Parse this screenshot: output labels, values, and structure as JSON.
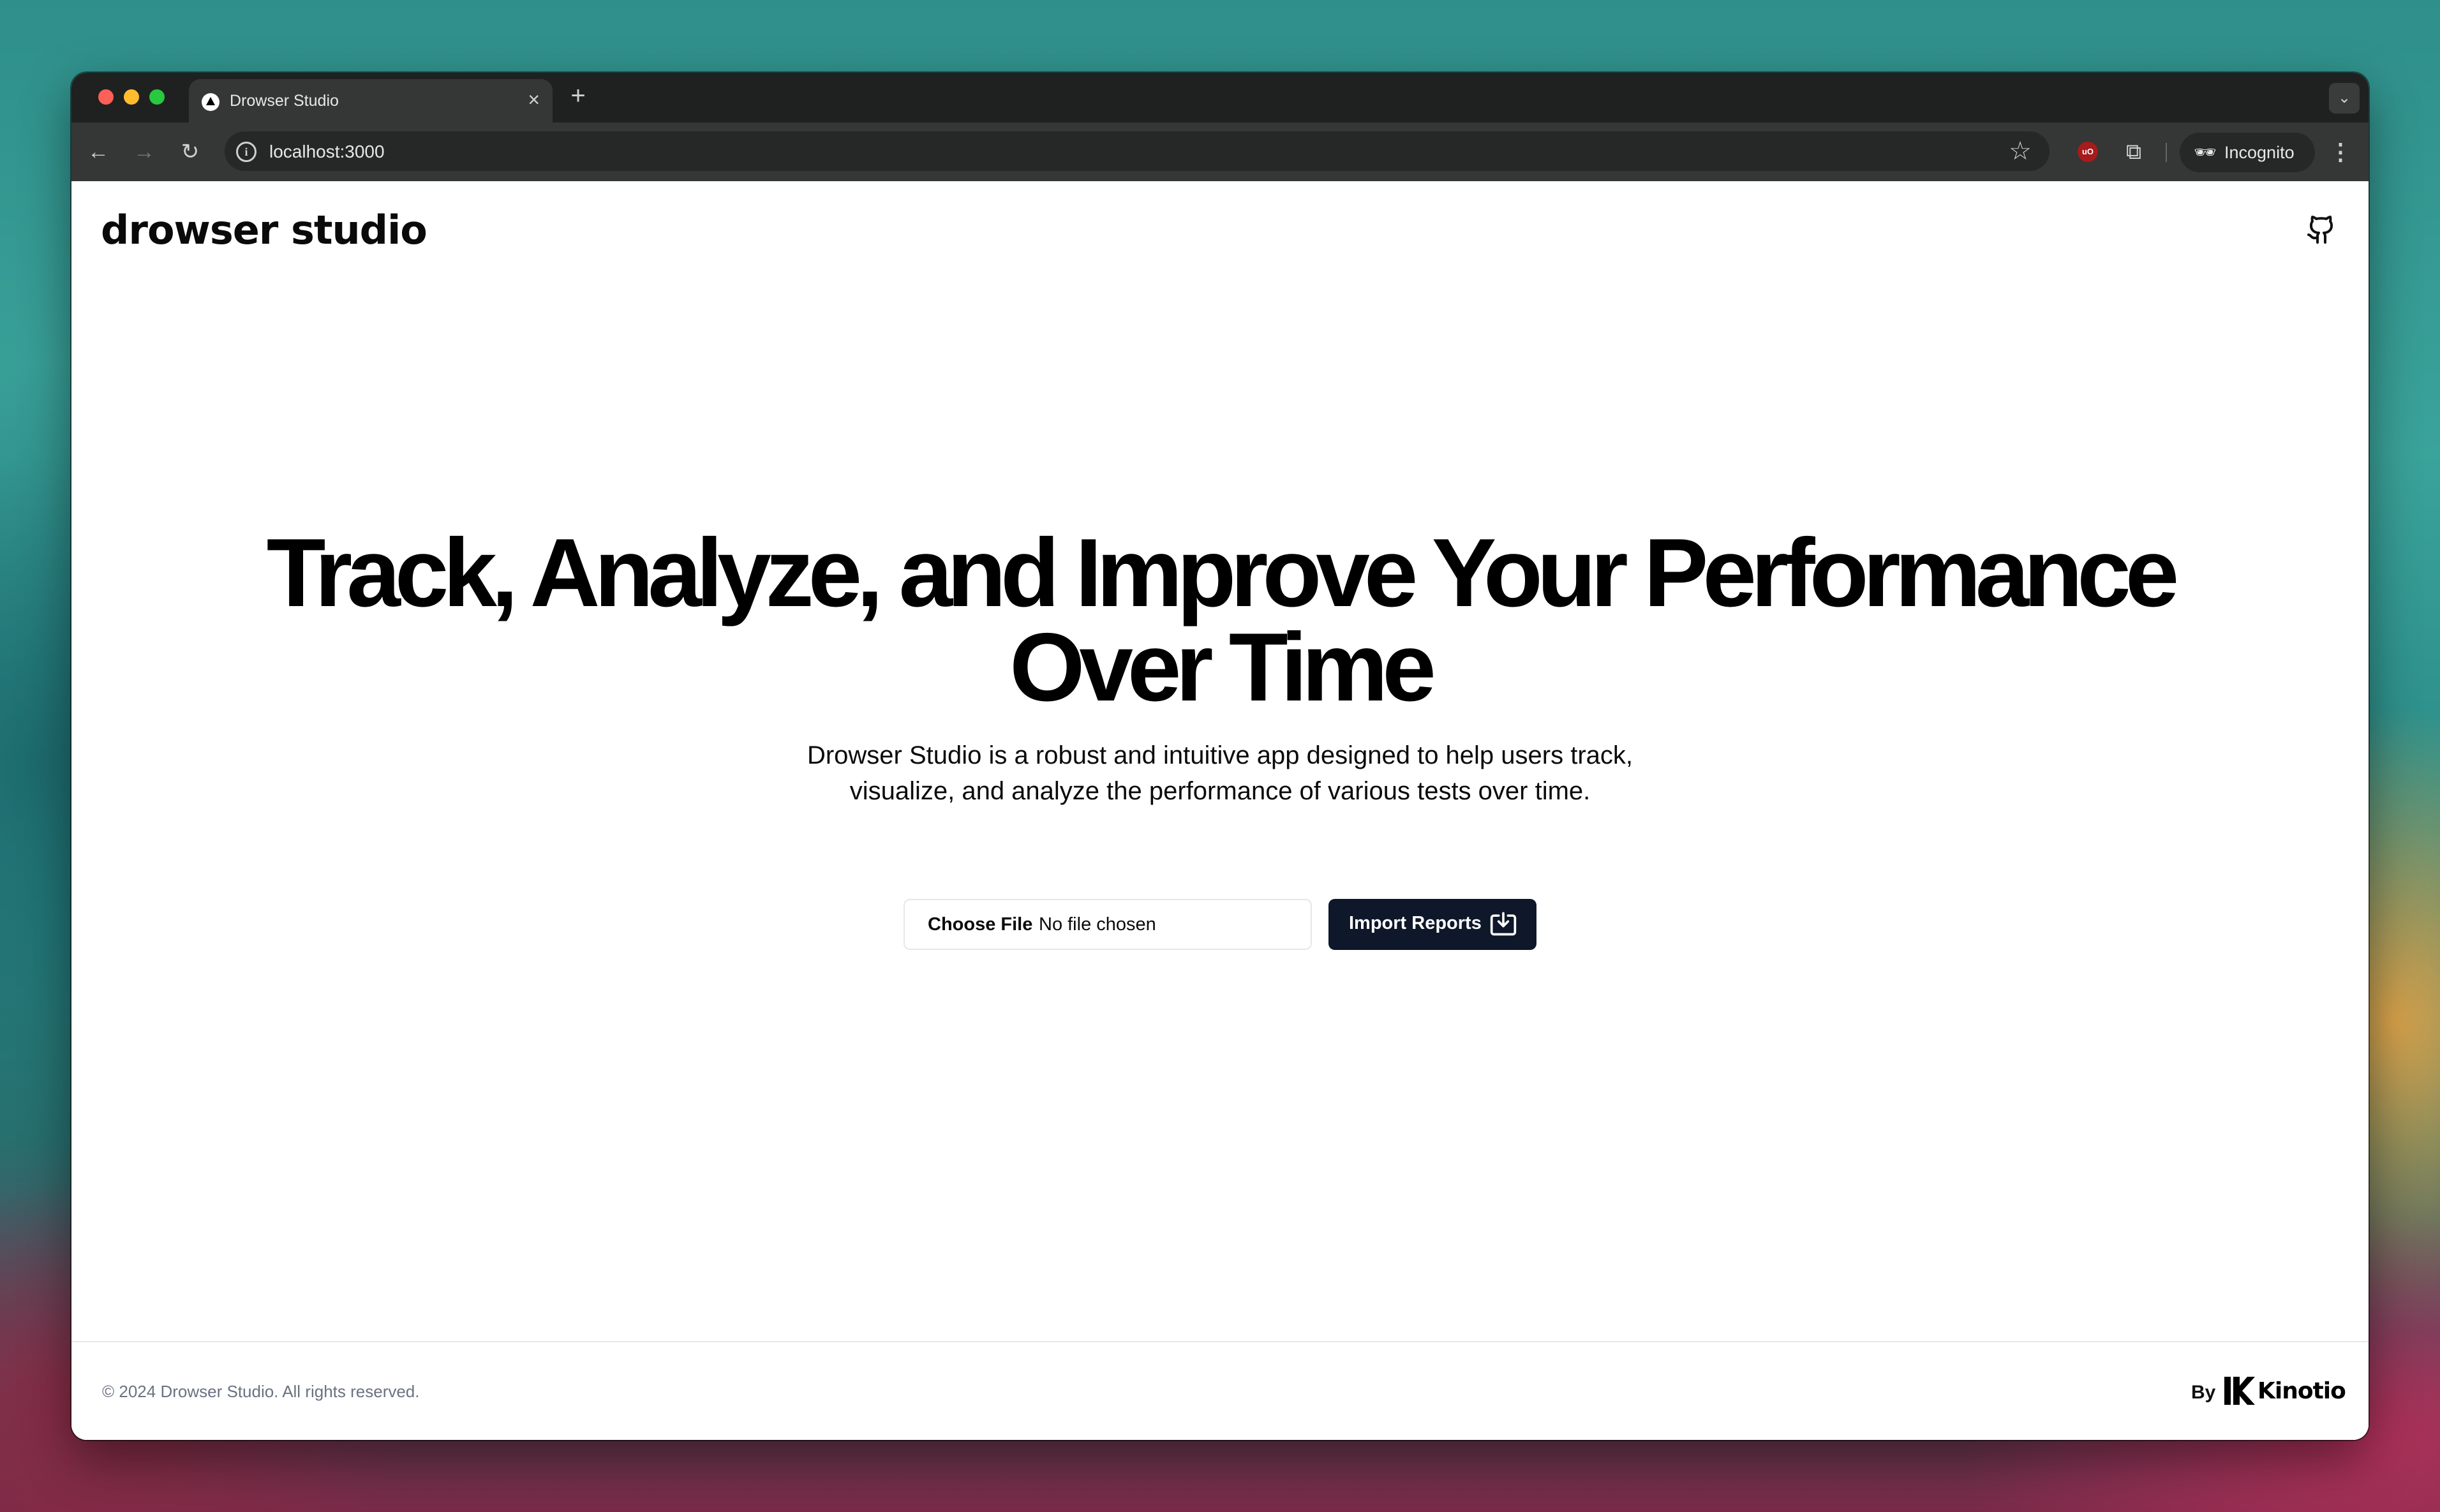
{
  "browser": {
    "tab_title": "Drowser Studio",
    "tab_close": "×",
    "new_tab": "+",
    "url": "localhost:3000",
    "profile_label": "Incognito",
    "extension_badge": "uO"
  },
  "header": {
    "logo": "drowser studio"
  },
  "hero": {
    "headline_line1": "Track, Analyze, and Improve Your Performance",
    "headline_line2": "Over Time",
    "subtitle": "Drowser Studio is a robust and intuitive app designed to help users track, visualize, and analyze the performance of various tests over time."
  },
  "import": {
    "choose_file_label": "Choose File",
    "file_status": "No file chosen",
    "import_button_label": "Import Reports"
  },
  "footer": {
    "copyright": "© 2024 Drowser Studio. All rights reserved.",
    "by_label": "By",
    "brand_name": "Kinotio"
  },
  "colors": {
    "primary_button": "#0f172a",
    "tab_bar": "#1f2020",
    "toolbar": "#353636",
    "footer_text": "#6b7280"
  }
}
